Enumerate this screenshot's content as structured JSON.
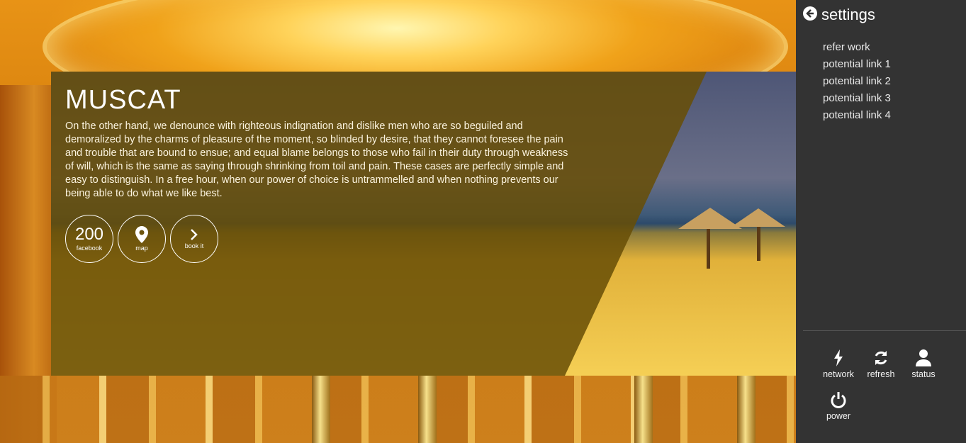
{
  "hero": {
    "city": "MUSCAT",
    "description": "On the other hand, we denounce with righteous indignation and dislike men who are so beguiled and demoralized by the charms of pleasure of the moment, so blinded by desire, that they cannot foresee the pain and trouble that are bound to ensue; and equal blame belongs to those who fail in their duty through weakness of will, which is the same as saying through shrinking from toil and pain. These cases are perfectly simple and easy to distinguish. In a free hour, when our power of choice is untrammelled and when nothing prevents our being able to do what we like best.",
    "actions": {
      "facebook_count": "200",
      "facebook_label": "facebook",
      "map_label": "map",
      "book_label": "book it"
    }
  },
  "sidebar": {
    "title": "settings",
    "back_icon": "arrow-circle-left-icon",
    "links": [
      "refer work",
      "potential link 1",
      "potential link 2",
      "potential link 3",
      "potential link 4"
    ],
    "controls": {
      "network": "network",
      "refresh": "refresh",
      "status": "status",
      "power": "power"
    }
  },
  "colors": {
    "overlay": "#684e06",
    "sidebar_bg": "#333333",
    "text": "#ffffff"
  }
}
